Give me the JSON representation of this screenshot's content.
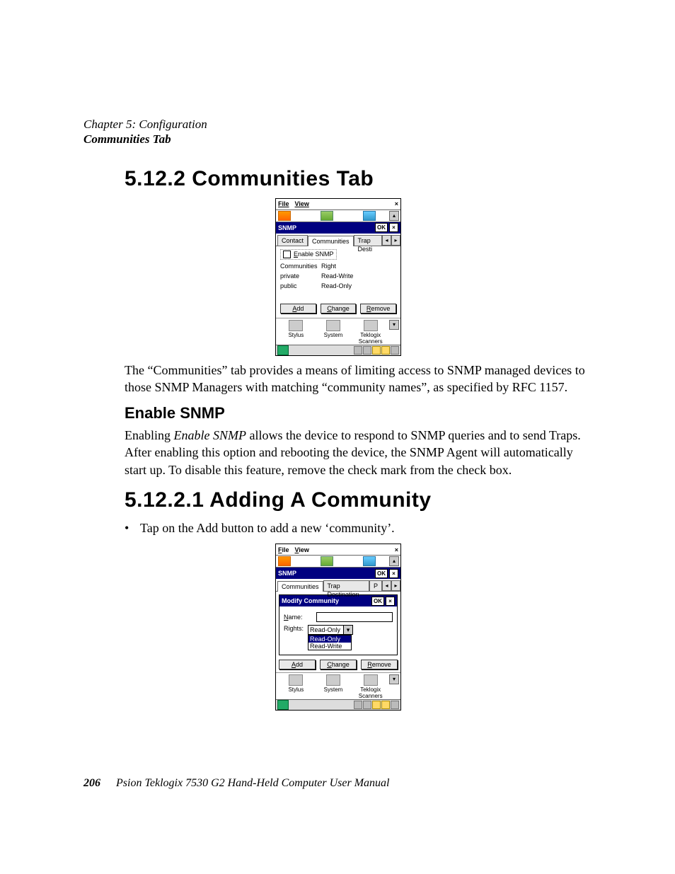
{
  "header": {
    "chapter": "Chapter 5: Configuration",
    "section": "Communities Tab"
  },
  "h_5_12_2": "5.12.2  Communities Tab",
  "para1": "The “Communities” tab provides a means of limiting access to SNMP managed devices to those SNMP Managers with matching “community names”, as specified by RFC 1157.",
  "h_enable": "Enable SNMP",
  "para2a": "Enabling ",
  "para2i": "Enable SNMP",
  "para2b": " allows the device to respond to SNMP queries and to send Traps. After enabling this option and rebooting the device, the SNMP Agent will automatically start up. To disable this feature, remove the check mark from the check box.",
  "h_5_12_2_1": "5.12.2.1  Adding A Community",
  "bullet1a": "Tap on the ",
  "bullet1bold": "Add",
  "bullet1b": " button to add a new ‘community’.",
  "footer": {
    "page": "206",
    "title": "Psion Teklogix 7530 G2 Hand-Held Computer User Manual"
  },
  "shot1": {
    "menu_file": "File",
    "menu_view": "View",
    "close_x": "×",
    "title": "SNMP",
    "ok": "OK",
    "tx": "×",
    "tab_contact": "Contact",
    "tab_communities": "Communities",
    "tab_trap": "Trap Desti",
    "enable_snmp_label": "Enable SNMP",
    "col_comm": "Communities",
    "col_right": "Right",
    "rows": [
      {
        "name": "private",
        "right": "Read-Write"
      },
      {
        "name": "public",
        "right": "Read-Only"
      }
    ],
    "btn_add": "Add",
    "btn_change": "Change",
    "btn_remove": "Remove",
    "icon_stylus": "Stylus",
    "icon_system": "System",
    "icon_tek": "Teklogix Scanners"
  },
  "shot2": {
    "menu_file": "File",
    "menu_view": "View",
    "close_x": "×",
    "title": "SNMP",
    "ok": "OK",
    "tx": "×",
    "tab_communities": "Communities",
    "tab_trap": "Trap Destination",
    "tab_p": "P",
    "dlg_title": "Modify Community",
    "lbl_name": "Name:",
    "lbl_rights": "Rights:",
    "combo_value": "Read-Only",
    "opt_ro": "Read-Only",
    "opt_rw": "Read-Write",
    "btn_add": "Add",
    "btn_change": "Change",
    "btn_remove": "Remove",
    "icon_stylus": "Stylus",
    "icon_system": "System",
    "icon_tek": "Teklogix Scanners"
  }
}
